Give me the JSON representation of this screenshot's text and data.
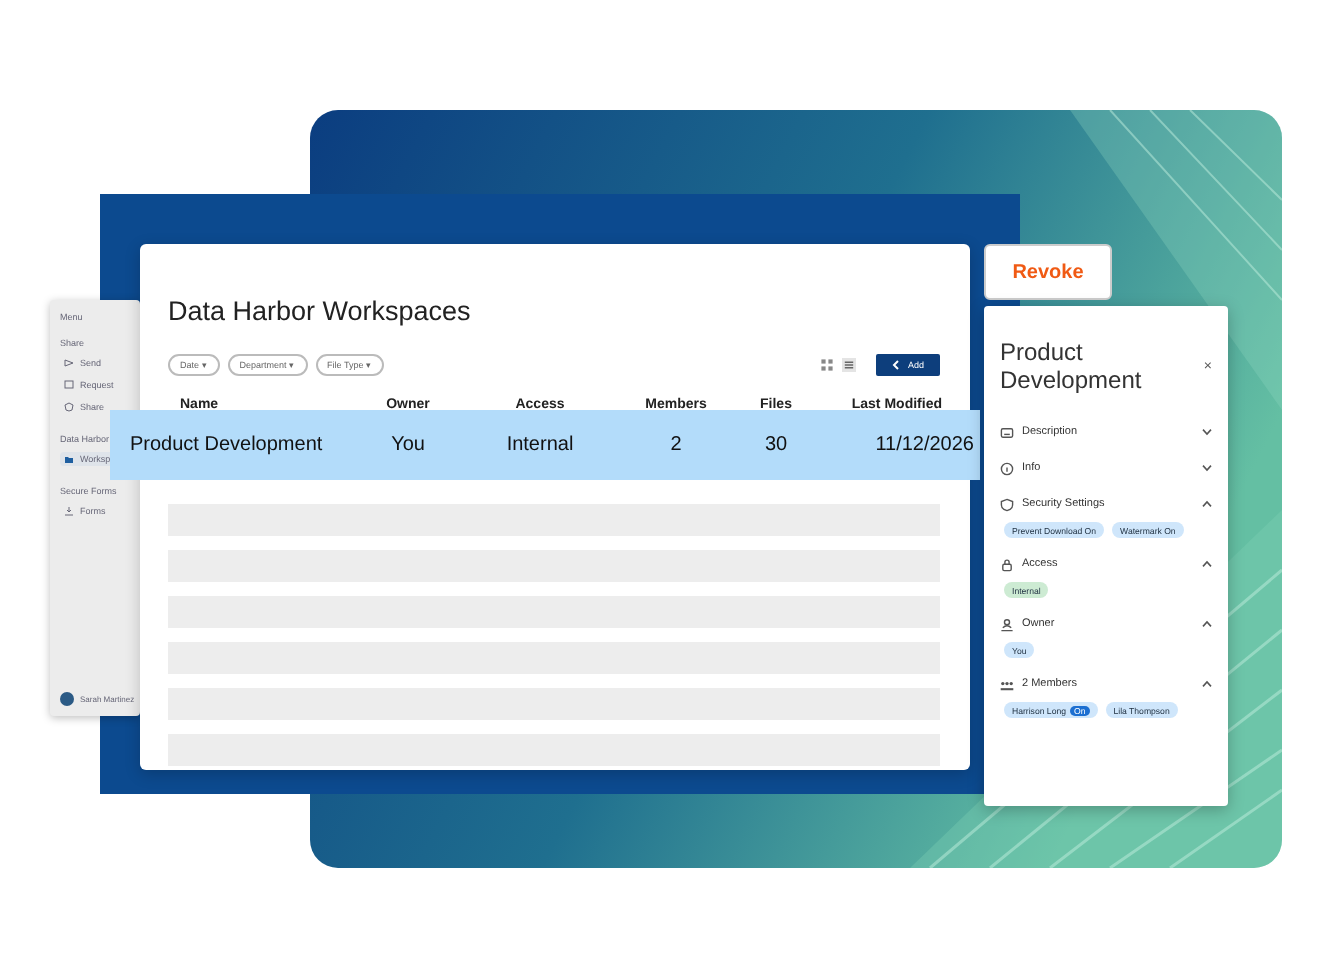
{
  "sidebar": {
    "heading": "Menu",
    "groups": [
      {
        "label": "Share",
        "items": [
          {
            "label": "Send",
            "selected": false
          },
          {
            "label": "Request",
            "selected": false
          },
          {
            "label": "Share",
            "selected": false
          }
        ]
      },
      {
        "label": "Data Harbor",
        "items": [
          {
            "label": "Worksp",
            "selected": true
          }
        ]
      },
      {
        "label": "Secure Forms",
        "items": [
          {
            "label": "Forms",
            "selected": false
          }
        ]
      }
    ],
    "user": "Sarah Martinez"
  },
  "workspace": {
    "title": "Data Harbor Workspaces",
    "filters": [
      "Date ▾",
      "Department ▾",
      "File Type ▾"
    ],
    "add_button": "Add",
    "columns": [
      "Name",
      "Owner",
      "Access",
      "Members",
      "Files",
      "Last Modified"
    ],
    "rows": [
      {
        "cells": [
          "Product Development",
          "You",
          "Internal",
          "2",
          "30",
          "11/12/2026"
        ],
        "selected": true
      }
    ]
  },
  "revoke_button": "Revoke",
  "details": {
    "title": "Product Development",
    "close": "×",
    "sections": [
      {
        "label": "Description",
        "expanded": false
      },
      {
        "label": "Info",
        "expanded": false
      },
      {
        "label": "Security Settings",
        "expanded": true,
        "chips": [
          {
            "text": "Prevent Download On",
            "color": "#cfe6fb"
          },
          {
            "text": "Watermark On",
            "color": "#cfe6fb"
          }
        ]
      },
      {
        "label": "Access",
        "expanded": true,
        "chips": [
          {
            "text": "Internal",
            "color": "#cdebd3"
          }
        ]
      },
      {
        "label": "Owner",
        "expanded": true,
        "chips": [
          {
            "text": "You",
            "color": "#cfe6fb"
          }
        ]
      },
      {
        "label": "2 Members",
        "expanded": true,
        "chips": [
          {
            "text": "Harrison Long",
            "color": "#cfe6fb",
            "badge": "On"
          },
          {
            "text": "Lila Thompson",
            "color": "#cfe6fb"
          }
        ]
      }
    ]
  }
}
